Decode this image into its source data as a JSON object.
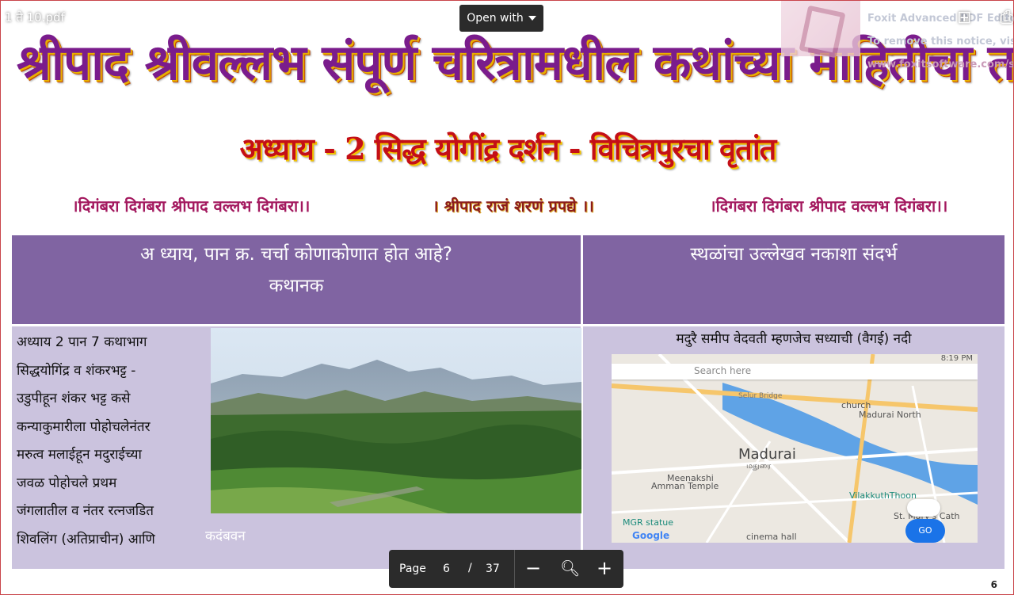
{
  "viewer": {
    "filename": "1 ते 10.pdf",
    "open_with": "Open with",
    "add_icon": "add-to-drive-icon",
    "print_icon": "print-icon"
  },
  "foxit": {
    "line1": "Foxit Advanced PDF Editor",
    "line2": "To remove this notice, visit:",
    "line3": "www.foxitsoftware.com/shopping"
  },
  "document": {
    "title": "श्रीपाद श्रीवल्लभ संपूर्ण चरित्रामधील कथांच्या माहितीचा तक्ता",
    "subtitle": "अध्याय - 2 सिद्ध योगींद्र दर्शन - विचित्रपुरचा वृतांत",
    "chant_left": "।दिगंबरा दिगंबरा श्रीपाद वल्लभ दिगंबरा।।",
    "chant_mid": "। श्रीपाद राजं शरणं प्रपद्ये ।।",
    "chant_right": "।दिगंबरा दिगंबरा श्रीपाद वल्लभ दिगंबरा।।",
    "page_number": "6"
  },
  "table": {
    "header_left_line1": "अ ध्याय, पान क्र. चर्चा कोणाकोणात होत आहे?",
    "header_left_line2": "कथानक",
    "header_right": "स्थळांचा उल्लेखव नकाशा संदर्भ",
    "story_lines": [
      "अध्याय 2 पान 7 कथाभाग",
      "सिद्धयोगिंद्र व शंकरभट्ट -",
      "उडुपीहून शंकर भट्ट कसे",
      "कन्याकुमारीला पोहोचलेनंतर",
      "मरुत्व मलाईहून मदुराईच्या",
      "जवळ पोहोचले प्रथम",
      "जंगलातील व नंतर रत्नजडित",
      "शिवलिंग (अतिप्राचीन) आणि"
    ],
    "photo_caption": "कदंबवन",
    "map_caption": "मदुरै समीप वेदवती म्हणजेच सध्याची (वैगई) नदी"
  },
  "map": {
    "search_placeholder": "Search here",
    "status_time": "8:19 PM",
    "city": "Madurai",
    "city_local": "மதுரை",
    "labels": {
      "north": "Madurai North",
      "church": "church",
      "temple1": "Meenakshi",
      "temple2": "Amman Temple",
      "villa": "VilakkuthThoon",
      "stmary": "St. Mary's Cath",
      "mgr": "MGR statue",
      "bridge": "Selur Bridge",
      "cinema": "cinema hall"
    },
    "google": "Google",
    "go": "GO"
  },
  "pager": {
    "label": "Page",
    "current": "6",
    "separator": "/",
    "total": "37",
    "zoom_out_icon": "zoom-out-icon",
    "zoom_icon": "magnifier-icon",
    "zoom_in_icon": "zoom-in-icon"
  }
}
